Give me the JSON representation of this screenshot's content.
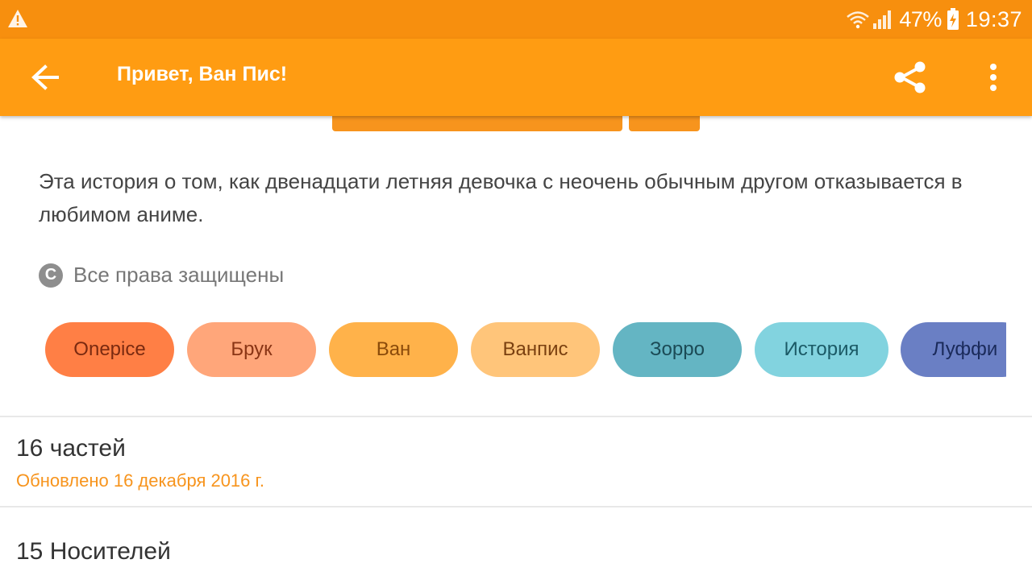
{
  "status_bar": {
    "battery": "47%",
    "time": "19:37",
    "icons": [
      "warning-icon",
      "wifi-icon",
      "signal-icon",
      "battery-charging-icon"
    ]
  },
  "app_bar": {
    "title": "Привет, Ван Пис!",
    "icons": [
      "arrow-back-icon",
      "share-icon",
      "more-vert-icon"
    ]
  },
  "story": {
    "description": "Эта история о том, как двенадцати летняя девочка с неочень обычным другом отказывается в любимом аниме.",
    "copyright_symbol": "C",
    "rights": "Все права защищены"
  },
  "tags": [
    {
      "label": "Onepice",
      "bg": "#FF7F45",
      "fg": "#7A2A10"
    },
    {
      "label": "Брук",
      "bg": "#FFA67A",
      "fg": "#8A3515"
    },
    {
      "label": "Ван",
      "bg": "#FFB24A",
      "fg": "#8A4A0A"
    },
    {
      "label": "Ванпис",
      "bg": "#FFC57A",
      "fg": "#7A4010"
    },
    {
      "label": "Зорро",
      "bg": "#64B5C3",
      "fg": "#1B4A55"
    },
    {
      "label": "История",
      "bg": "#82D3DF",
      "fg": "#1B5A66"
    },
    {
      "label": "Луффи",
      "bg": "#6A7FC4",
      "fg": "#1A2A5A"
    }
  ],
  "parts": {
    "count_label": "16 частей",
    "updated": "Обновлено 16 декабря 2016 г."
  },
  "readers": {
    "label": "15 Носителей"
  },
  "colors": {
    "status_bar": "#F78F0E",
    "app_bar": "#FF9C12",
    "accent": "#F7941D"
  }
}
